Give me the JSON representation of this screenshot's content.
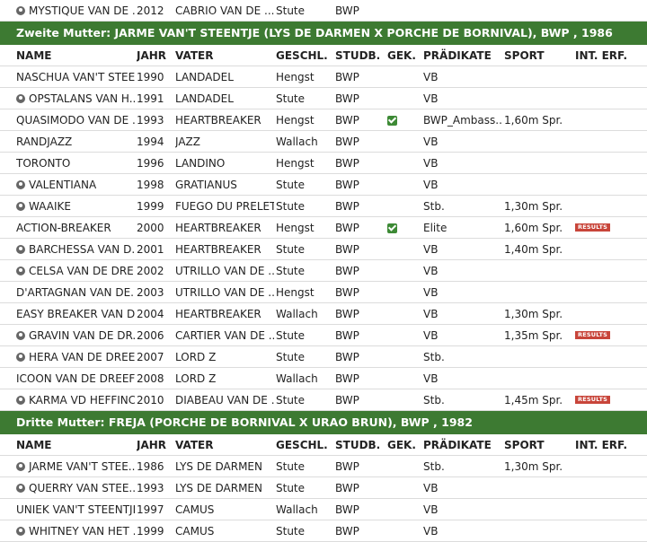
{
  "columns": {
    "name": "NAME",
    "year": "JAHR",
    "father": "VATER",
    "sex": "GESCHL.",
    "studbook": "STUDB.",
    "gek": "GEK.",
    "predicate": "PRÄDIKATE",
    "sport": "SPORT",
    "int": "INT. ERF."
  },
  "colors": {
    "section_bg": "#3d7a32",
    "badge": "#c8453a",
    "check": "#3d8a35"
  },
  "top_row": {
    "name": "MYSTIQUE VAN DE ...",
    "female": true,
    "year": "2012",
    "father": "CABRIO VAN DE ...",
    "sex": "Stute",
    "studbook": "BWP",
    "gek": false,
    "predicate": "",
    "sport": "",
    "results": ""
  },
  "sections": [
    {
      "title": "Zweite Mutter: JARME VAN'T STEENTJE (LYS DE DARMEN X PORCHE DE BORNIVAL), BWP , 1986",
      "rows": [
        {
          "name": "NASCHUA VAN'T STEE...",
          "female": false,
          "year": "1990",
          "father": "LANDADEL",
          "sex": "Hengst",
          "studbook": "BWP",
          "gek": false,
          "predicate": "VB",
          "sport": "",
          "results": ""
        },
        {
          "name": "OPSTALANS VAN H...",
          "female": true,
          "year": "1991",
          "father": "LANDADEL",
          "sex": "Stute",
          "studbook": "BWP",
          "gek": false,
          "predicate": "VB",
          "sport": "",
          "results": ""
        },
        {
          "name": "QUASIMODO VAN DE ...",
          "female": false,
          "year": "1993",
          "father": "HEARTBREAKER",
          "sex": "Hengst",
          "studbook": "BWP",
          "gek": true,
          "predicate": "BWP_Ambass...",
          "sport": "1,60m Spr.",
          "results": ""
        },
        {
          "name": "RANDJAZZ",
          "female": false,
          "year": "1994",
          "father": "JAZZ",
          "sex": "Wallach",
          "studbook": "BWP",
          "gek": false,
          "predicate": "VB",
          "sport": "",
          "results": ""
        },
        {
          "name": "TORONTO",
          "female": false,
          "year": "1996",
          "father": "LANDINO",
          "sex": "Hengst",
          "studbook": "BWP",
          "gek": false,
          "predicate": "VB",
          "sport": "",
          "results": ""
        },
        {
          "name": "VALENTIANA",
          "female": true,
          "year": "1998",
          "father": "GRATIANUS",
          "sex": "Stute",
          "studbook": "BWP",
          "gek": false,
          "predicate": "VB",
          "sport": "",
          "results": ""
        },
        {
          "name": "WAAIKE",
          "female": true,
          "year": "1999",
          "father": "FUEGO DU PRELET",
          "sex": "Stute",
          "studbook": "BWP",
          "gek": false,
          "predicate": "Stb.",
          "sport": "1,30m Spr.",
          "results": ""
        },
        {
          "name": "ACTION-BREAKER",
          "female": false,
          "year": "2000",
          "father": "HEARTBREAKER",
          "sex": "Hengst",
          "studbook": "BWP",
          "gek": true,
          "predicate": "Elite",
          "sport": "1,60m Spr.",
          "results": "RESULTS"
        },
        {
          "name": "BARCHESSA VAN D...",
          "female": true,
          "year": "2001",
          "father": "HEARTBREAKER",
          "sex": "Stute",
          "studbook": "BWP",
          "gek": false,
          "predicate": "VB",
          "sport": "1,40m Spr.",
          "results": ""
        },
        {
          "name": "CELSA VAN DE DRE...",
          "female": true,
          "year": "2002",
          "father": "UTRILLO VAN DE ...",
          "sex": "Stute",
          "studbook": "BWP",
          "gek": false,
          "predicate": "VB",
          "sport": "",
          "results": ""
        },
        {
          "name": "D'ARTAGNAN VAN DE...",
          "female": false,
          "year": "2003",
          "father": "UTRILLO VAN DE ...",
          "sex": "Hengst",
          "studbook": "BWP",
          "gek": false,
          "predicate": "VB",
          "sport": "",
          "results": ""
        },
        {
          "name": "EASY BREAKER VAN D...",
          "female": false,
          "year": "2004",
          "father": "HEARTBREAKER",
          "sex": "Wallach",
          "studbook": "BWP",
          "gek": false,
          "predicate": "VB",
          "sport": "1,30m Spr.",
          "results": ""
        },
        {
          "name": "GRAVIN VAN DE DR...",
          "female": true,
          "year": "2006",
          "father": "CARTIER VAN DE ...",
          "sex": "Stute",
          "studbook": "BWP",
          "gek": false,
          "predicate": "VB",
          "sport": "1,35m Spr.",
          "results": "RESULTS"
        },
        {
          "name": "HERA VAN DE DREEF",
          "female": true,
          "year": "2007",
          "father": "LORD Z",
          "sex": "Stute",
          "studbook": "BWP",
          "gek": false,
          "predicate": "Stb.",
          "sport": "",
          "results": ""
        },
        {
          "name": "ICOON VAN DE DREEF",
          "female": false,
          "year": "2008",
          "father": "LORD Z",
          "sex": "Wallach",
          "studbook": "BWP",
          "gek": false,
          "predicate": "VB",
          "sport": "",
          "results": ""
        },
        {
          "name": "KARMA VD HEFFINCK",
          "female": true,
          "year": "2010",
          "father": "DIABEAU VAN DE ...",
          "sex": "Stute",
          "studbook": "BWP",
          "gek": false,
          "predicate": "Stb.",
          "sport": "1,45m Spr.",
          "results": "RESULTS"
        }
      ]
    },
    {
      "title": "Dritte Mutter: FREJA (PORCHE DE BORNIVAL X URAO BRUN), BWP , 1982",
      "rows": [
        {
          "name": "JARME VAN'T STEE...",
          "female": true,
          "year": "1986",
          "father": "LYS DE DARMEN",
          "sex": "Stute",
          "studbook": "BWP",
          "gek": false,
          "predicate": "Stb.",
          "sport": "1,30m Spr.",
          "results": ""
        },
        {
          "name": "QUERRY VAN STEE...",
          "female": true,
          "year": "1993",
          "father": "LYS DE DARMEN",
          "sex": "Stute",
          "studbook": "BWP",
          "gek": false,
          "predicate": "VB",
          "sport": "",
          "results": ""
        },
        {
          "name": "UNIEK VAN'T STEENTJE",
          "female": false,
          "year": "1997",
          "father": "CAMUS",
          "sex": "Wallach",
          "studbook": "BWP",
          "gek": false,
          "predicate": "VB",
          "sport": "",
          "results": ""
        },
        {
          "name": "WHITNEY VAN HET ...",
          "female": true,
          "year": "1999",
          "father": "CAMUS",
          "sex": "Stute",
          "studbook": "BWP",
          "gek": false,
          "predicate": "VB",
          "sport": "",
          "results": ""
        }
      ]
    }
  ]
}
